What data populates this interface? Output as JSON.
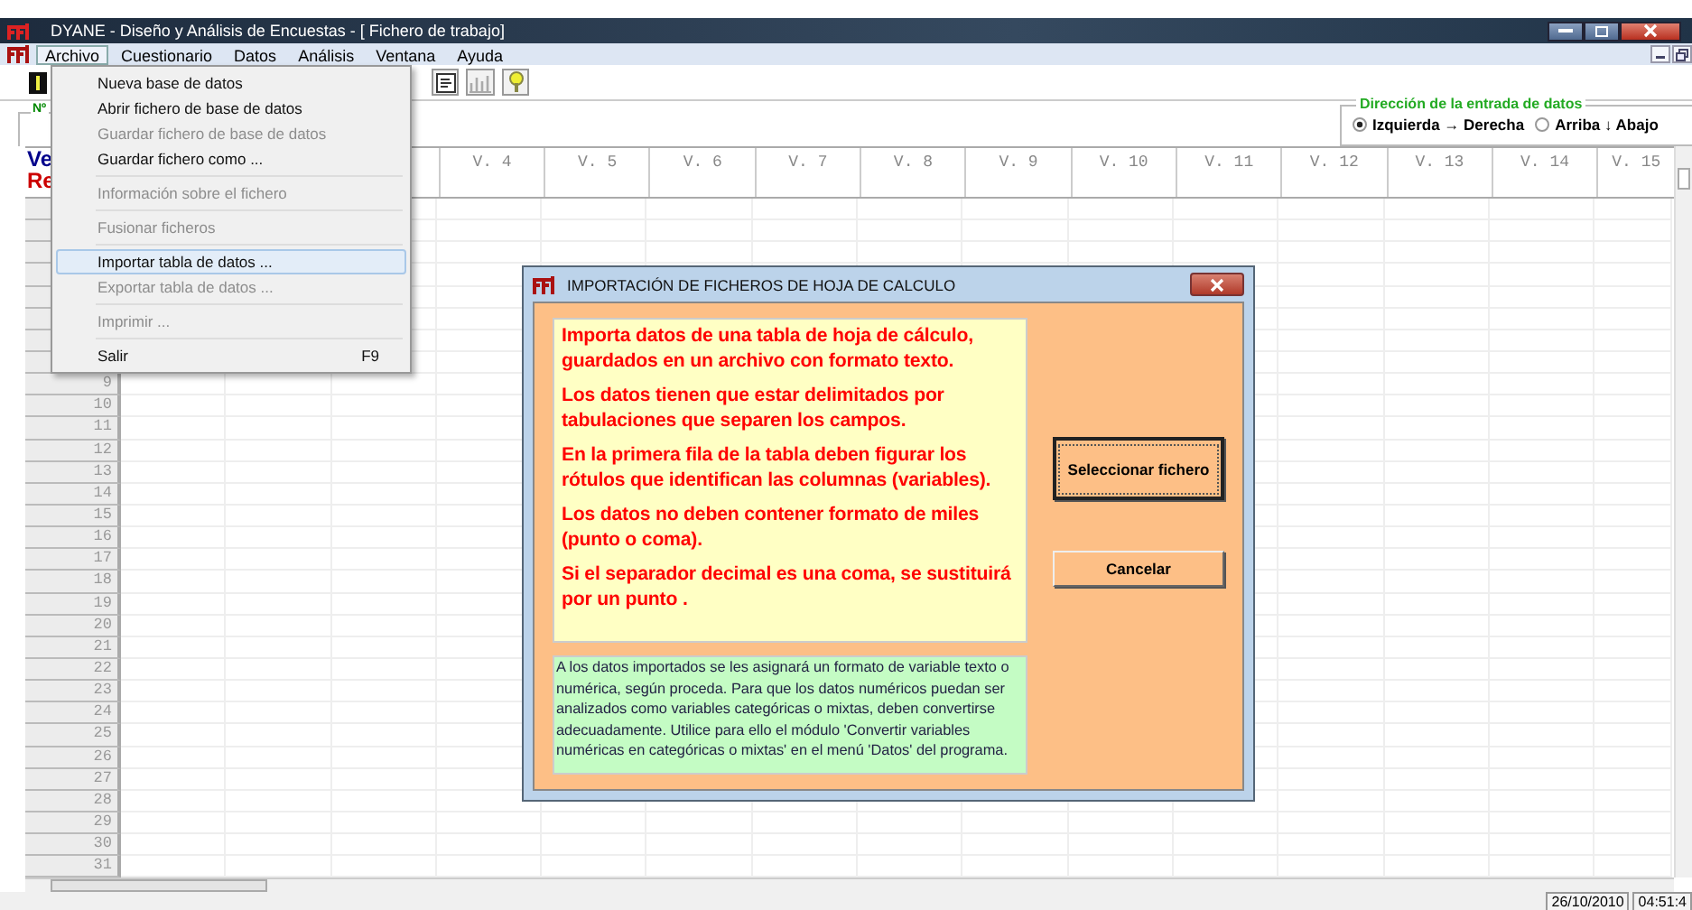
{
  "window": {
    "title": "DYANE - Diseño y Análisis de Encuestas - [ Fichero de trabajo]"
  },
  "menubar": [
    {
      "label": "Archivo",
      "selected": true
    },
    {
      "label": "Cuestionario",
      "selected": false
    },
    {
      "label": "Datos",
      "selected": false
    },
    {
      "label": "Análisis",
      "selected": false
    },
    {
      "label": "Ventana",
      "selected": false
    },
    {
      "label": "Ayuda",
      "selected": false
    }
  ],
  "file_menu": [
    {
      "kind": "item",
      "label": "Nueva base de datos",
      "disabled": false,
      "selected": false
    },
    {
      "kind": "item",
      "label": "Abrir fichero de base de datos",
      "disabled": false,
      "selected": false
    },
    {
      "kind": "item",
      "label": "Guardar fichero de base de datos",
      "disabled": true,
      "selected": false
    },
    {
      "kind": "item",
      "label": "Guardar fichero como ...",
      "disabled": false,
      "selected": false
    },
    {
      "kind": "separator"
    },
    {
      "kind": "item",
      "label": "Información sobre el fichero",
      "disabled": true,
      "selected": false
    },
    {
      "kind": "separator"
    },
    {
      "kind": "item",
      "label": "Fusionar ficheros",
      "disabled": true,
      "selected": false
    },
    {
      "kind": "separator"
    },
    {
      "kind": "item",
      "label": "Importar tabla de datos ...",
      "disabled": false,
      "selected": true
    },
    {
      "kind": "item",
      "label": "Exportar tabla de datos ...",
      "disabled": true,
      "selected": false
    },
    {
      "kind": "separator"
    },
    {
      "kind": "item",
      "label": "Imprimir ...",
      "disabled": true,
      "selected": false
    },
    {
      "kind": "separator"
    },
    {
      "kind": "item",
      "label": "Salir",
      "shortcut": "F9",
      "disabled": false,
      "selected": false
    }
  ],
  "form_group": {
    "label": "Nº"
  },
  "direction_group": {
    "title": "Dirección de la entrada de datos",
    "options": [
      {
        "label": "Izquierda → Derecha",
        "selected": true
      },
      {
        "label": "Arriba ↓ Abajo",
        "selected": false
      }
    ]
  },
  "grid": {
    "corner_labels": [
      "Ve",
      "Re"
    ],
    "columns": [
      "V. 4",
      "V. 5",
      "V. 6",
      "V. 7",
      "V. 8",
      "V. 9",
      "V. 10",
      "V. 11",
      "V. 12",
      "V. 13",
      "V. 14",
      "V. 15"
    ],
    "row_numbers": [
      "9",
      "10",
      "11",
      "12",
      "13",
      "14",
      "15",
      "16",
      "17",
      "18",
      "19",
      "20",
      "21",
      "22",
      "23",
      "24",
      "25",
      "26",
      "27",
      "28",
      "29",
      "30",
      "31"
    ]
  },
  "dialog": {
    "title": "IMPORTACIÓN DE FICHEROS DE HOJA DE CALCULO",
    "instructions": [
      "Importa datos de una tabla de hoja de cálculo, guardados en un archivo con formato texto.",
      "Los datos tienen que estar delimitados por tabulaciones que separen los campos.",
      "En la primera fila de la tabla deben figurar los rótulos que identifican las columnas (variables).",
      "Los datos no deben contener formato de miles (punto o coma).",
      "Si el separador decimal es una coma, se sustituirá por un punto ."
    ],
    "note": "A los datos importados se les asignará un formato de variable texto o numérica, según proceda. Para que los datos numéricos puedan ser analizados como variables categóricas o mixtas, deben convertirse adecuadamente. Utilice para ello el módulo 'Convertir variables numéricas en categóricas o mixtas' en el menú 'Datos' del programa.",
    "buttons": [
      {
        "label": "Seleccionar fichero",
        "focused": true
      },
      {
        "label": "Cancelar",
        "focused": false
      }
    ]
  },
  "status_bar": [
    "26/10/2010",
    "04:51:4"
  ]
}
